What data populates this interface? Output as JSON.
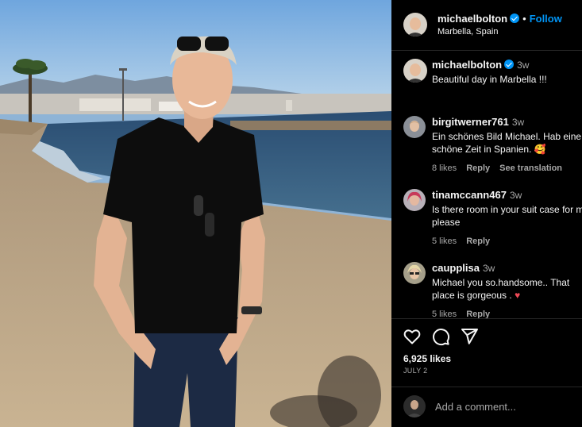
{
  "post": {
    "author": "michaelbolton",
    "follow_label": "Follow",
    "location": "Marbella, Spain",
    "separator": "•"
  },
  "caption": {
    "username": "michaelbolton",
    "time": "3w",
    "text": "Beautiful day in Marbella !!!"
  },
  "comments": [
    {
      "username": "birgitwerner761",
      "time": "3w",
      "text": "Ein schönes Bild Michael. Hab eine schöne Zeit in Spanien. 🥰",
      "likes": "8 likes",
      "reply": "Reply",
      "translate": "See translation"
    },
    {
      "username": "tinamccann467",
      "time": "3w",
      "text": "Is there room in your suit case for me please",
      "likes": "5 likes",
      "reply": "Reply"
    },
    {
      "username": "caupplisa",
      "time": "3w",
      "text": "Michael you so.handsome.. That place is gorgeous .",
      "heart": "♥",
      "likes": "5 likes",
      "reply": "Reply"
    }
  ],
  "engagement": {
    "likes": "6,925 likes",
    "date": "JULY 2"
  },
  "add_comment": {
    "placeholder": "Add a comment..."
  },
  "icons": [
    "heart-icon",
    "comment-icon",
    "share-icon",
    "verified-badge-icon"
  ],
  "colors": {
    "background": "#000000",
    "link_blue": "#0095f6",
    "muted": "#a8a8a8",
    "heart_red": "#ed4956"
  }
}
